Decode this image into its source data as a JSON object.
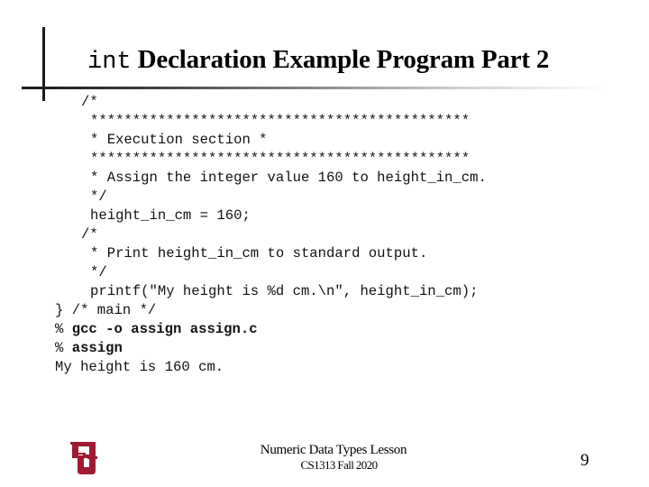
{
  "slide": {
    "title_code": "int",
    "title_text": " Declaration Example Program Part 2",
    "code_lines": [
      {
        "text": "/*",
        "bold": false
      },
      {
        "text": "*********************************************",
        "bold": false
      },
      {
        "text": "* Execution section *",
        "bold": false
      },
      {
        "text": "*********************************************",
        "bold": false
      },
      {
        "text": "* Assign the integer value 160 to height_in_cm.",
        "bold": false
      },
      {
        "text": "*/",
        "bold": false
      },
      {
        "text": "height_in_cm = 160;",
        "bold": false
      },
      {
        "text": "/*",
        "bold": false
      },
      {
        "text": "* Print height_in_cm to standard output.",
        "bold": false
      },
      {
        "text": "*/",
        "bold": false
      },
      {
        "text": "printf(\"My height is %d cm.\\n\", height_in_cm);",
        "bold": false
      },
      {
        "text": "} /* main */",
        "bold": false
      },
      {
        "text": "% ",
        "bold": false,
        "cmd": "gcc -o assign assign.c"
      },
      {
        "text": "% ",
        "bold": false,
        "cmd": "assign"
      },
      {
        "text": "My height is 160 cm.",
        "bold": false
      }
    ]
  },
  "footer": {
    "course": "Numeric Data Types Lesson",
    "term": "CS1313 Fall 2020",
    "page_number": "9",
    "logo": "ou-logo-icon",
    "logo_color": "#9E1B32"
  }
}
